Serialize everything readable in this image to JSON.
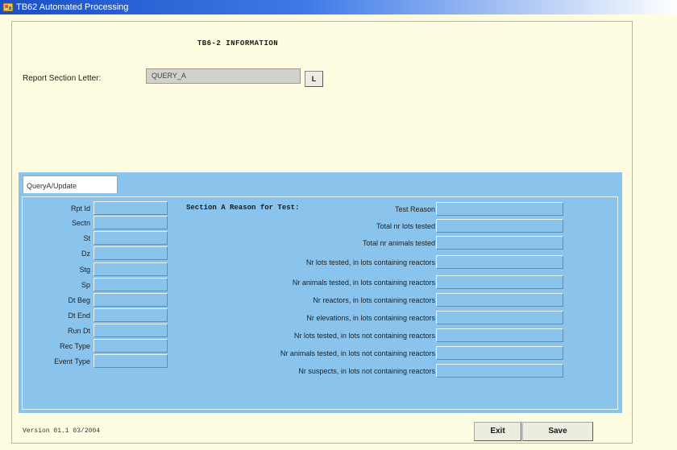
{
  "window": {
    "title": "TB62 Automated Processing",
    "icon": "app-window-icon"
  },
  "form": {
    "heading": "TB6-2 INFORMATION",
    "report_section_label": "Report Section Letter:",
    "report_section_value": "QUERY_A",
    "lov_button_label": "L"
  },
  "tabs": [
    {
      "label": "QueryA/Update",
      "selected": true
    }
  ],
  "left_fields": [
    {
      "label": "Rpt Id",
      "value": ""
    },
    {
      "label": "Sectn",
      "value": ""
    },
    {
      "label": "St",
      "value": ""
    },
    {
      "label": "Dz",
      "value": ""
    },
    {
      "label": "Stg",
      "value": ""
    },
    {
      "label": "Sp",
      "value": ""
    },
    {
      "label": "Dt Beg",
      "value": ""
    },
    {
      "label": "Dt End",
      "value": ""
    },
    {
      "label": "Run Dt",
      "value": ""
    },
    {
      "label": "Rec Type",
      "value": ""
    },
    {
      "label": "Event Type",
      "value": ""
    }
  ],
  "section_a": {
    "heading": "Section A Reason for Test:",
    "fields": [
      {
        "label": "Test Reason",
        "value": ""
      },
      {
        "label": "Total nr lots tested",
        "value": ""
      },
      {
        "label": "Total nr animals tested",
        "value": ""
      },
      {
        "label": "Nr lots tested, in lots containing reactors",
        "value": ""
      },
      {
        "label": "Nr animals tested, in lots containing reactors",
        "value": ""
      },
      {
        "label": "Nr reactors, in lots containing reactors",
        "value": ""
      },
      {
        "label": "Nr elevations, in lots containing reactors",
        "value": ""
      },
      {
        "label": "Nr lots tested, in lots not containing reactors",
        "value": ""
      },
      {
        "label": "Nr animals tested, in lots not containing reactors",
        "value": ""
      },
      {
        "label": "Nr suspects, in lots not containing reactors",
        "value": ""
      }
    ]
  },
  "footer": {
    "version": "Version 01.1 03/2004",
    "exit_label": "Exit",
    "save_label": "Save"
  },
  "colors": {
    "background": "#fffde1",
    "panel": "#8ac3ec",
    "titlebar": "#1a4fc6"
  }
}
